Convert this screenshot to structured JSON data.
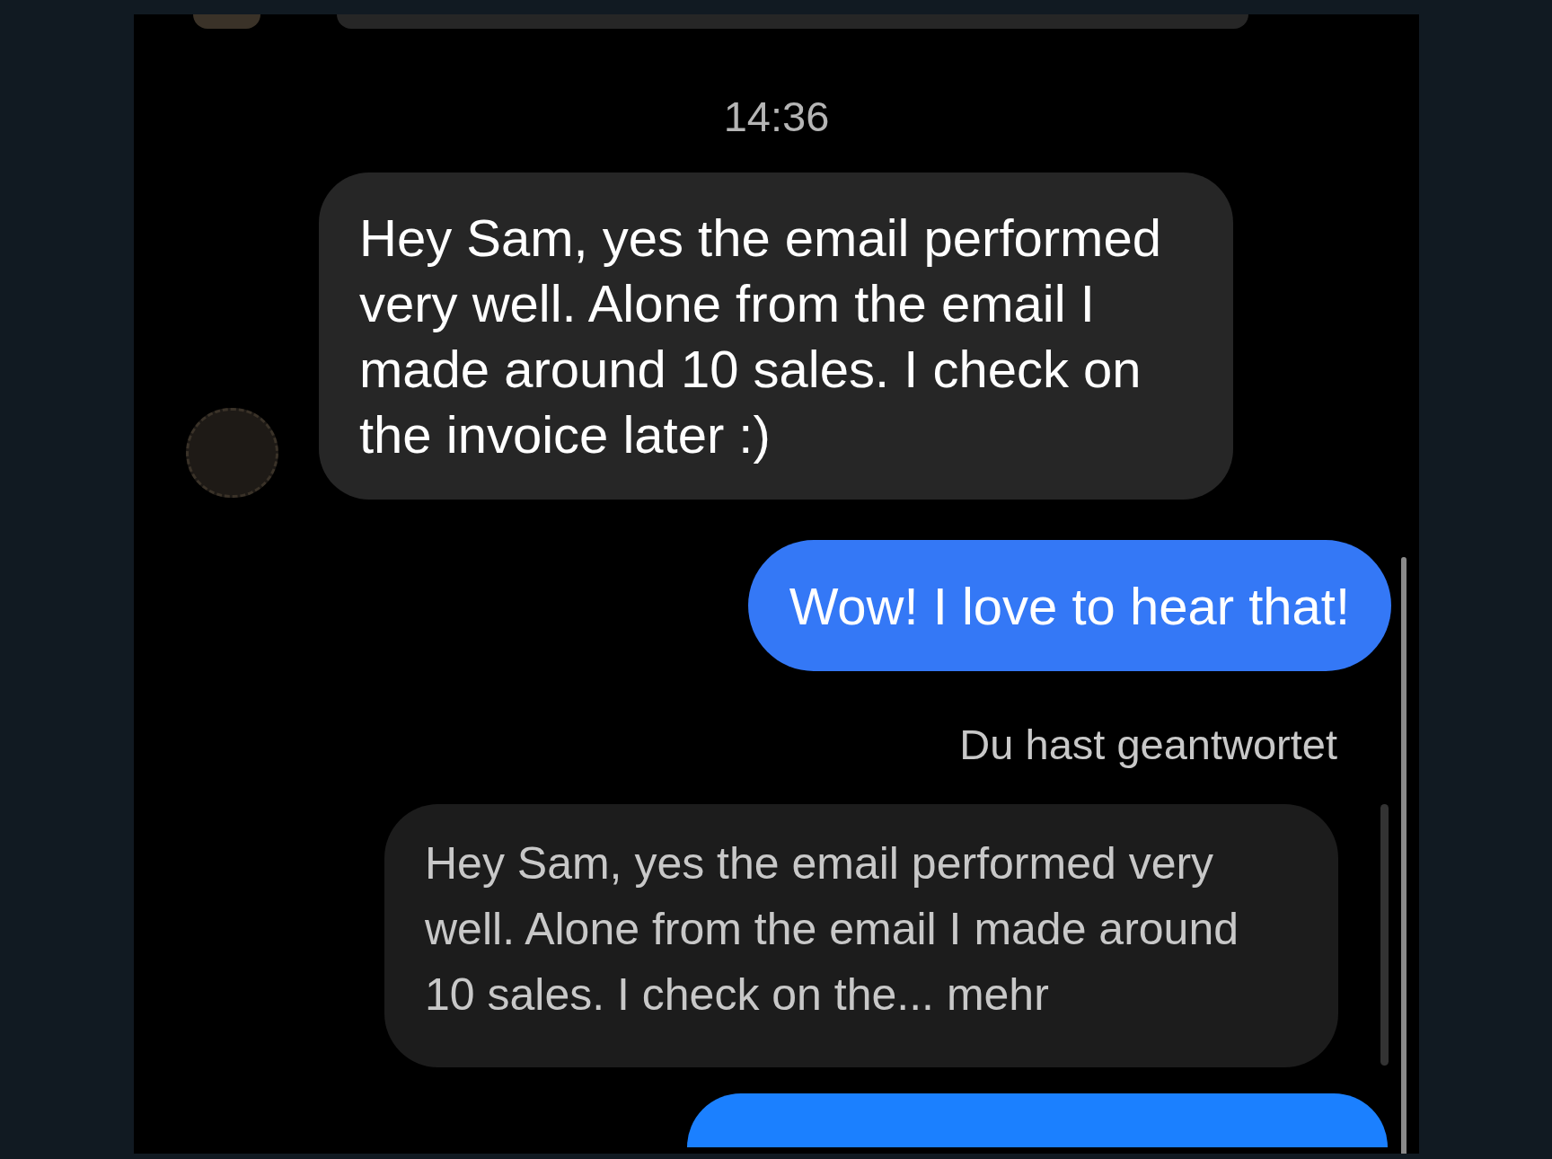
{
  "timestamp": "14:36",
  "messages": [
    {
      "kind": "incoming",
      "text": "Hey Sam, yes the email performed very well. Alone from the email I made around 10 sales. I check on the invoice later :)"
    },
    {
      "kind": "outgoing",
      "text": "Wow! I love to hear that!"
    },
    {
      "kind": "reply_label",
      "text": "Du hast geantwortet"
    },
    {
      "kind": "quote",
      "text": "Hey Sam, yes the email performed very well. Alone from the email I made around 10 sales. I check on the... mehr"
    },
    {
      "kind": "outgoing_partial"
    }
  ]
}
